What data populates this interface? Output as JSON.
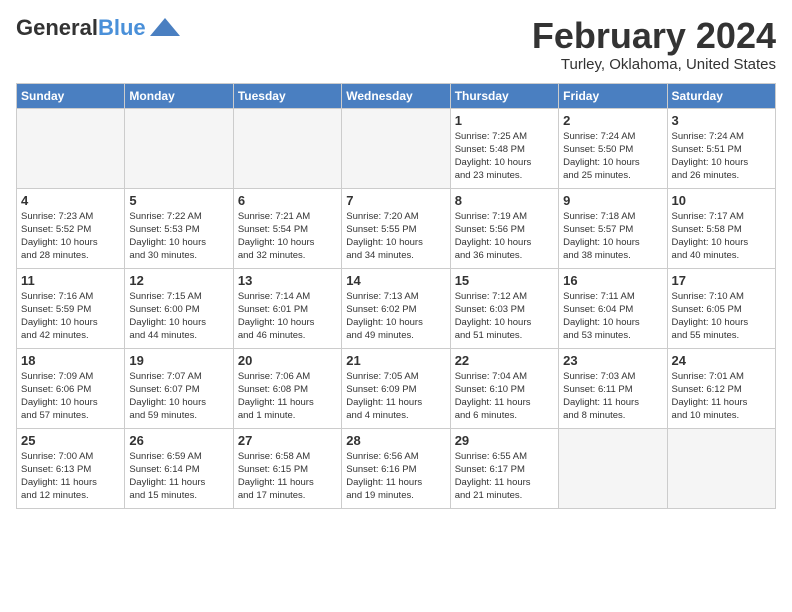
{
  "header": {
    "logo_line1": "General",
    "logo_line2": "Blue",
    "month": "February 2024",
    "location": "Turley, Oklahoma, United States"
  },
  "days_of_week": [
    "Sunday",
    "Monday",
    "Tuesday",
    "Wednesday",
    "Thursday",
    "Friday",
    "Saturday"
  ],
  "weeks": [
    [
      {
        "num": "",
        "info": "",
        "empty": true
      },
      {
        "num": "",
        "info": "",
        "empty": true
      },
      {
        "num": "",
        "info": "",
        "empty": true
      },
      {
        "num": "",
        "info": "",
        "empty": true
      },
      {
        "num": "1",
        "info": "Sunrise: 7:25 AM\nSunset: 5:48 PM\nDaylight: 10 hours\nand 23 minutes.",
        "empty": false
      },
      {
        "num": "2",
        "info": "Sunrise: 7:24 AM\nSunset: 5:50 PM\nDaylight: 10 hours\nand 25 minutes.",
        "empty": false
      },
      {
        "num": "3",
        "info": "Sunrise: 7:24 AM\nSunset: 5:51 PM\nDaylight: 10 hours\nand 26 minutes.",
        "empty": false
      }
    ],
    [
      {
        "num": "4",
        "info": "Sunrise: 7:23 AM\nSunset: 5:52 PM\nDaylight: 10 hours\nand 28 minutes.",
        "empty": false
      },
      {
        "num": "5",
        "info": "Sunrise: 7:22 AM\nSunset: 5:53 PM\nDaylight: 10 hours\nand 30 minutes.",
        "empty": false
      },
      {
        "num": "6",
        "info": "Sunrise: 7:21 AM\nSunset: 5:54 PM\nDaylight: 10 hours\nand 32 minutes.",
        "empty": false
      },
      {
        "num": "7",
        "info": "Sunrise: 7:20 AM\nSunset: 5:55 PM\nDaylight: 10 hours\nand 34 minutes.",
        "empty": false
      },
      {
        "num": "8",
        "info": "Sunrise: 7:19 AM\nSunset: 5:56 PM\nDaylight: 10 hours\nand 36 minutes.",
        "empty": false
      },
      {
        "num": "9",
        "info": "Sunrise: 7:18 AM\nSunset: 5:57 PM\nDaylight: 10 hours\nand 38 minutes.",
        "empty": false
      },
      {
        "num": "10",
        "info": "Sunrise: 7:17 AM\nSunset: 5:58 PM\nDaylight: 10 hours\nand 40 minutes.",
        "empty": false
      }
    ],
    [
      {
        "num": "11",
        "info": "Sunrise: 7:16 AM\nSunset: 5:59 PM\nDaylight: 10 hours\nand 42 minutes.",
        "empty": false
      },
      {
        "num": "12",
        "info": "Sunrise: 7:15 AM\nSunset: 6:00 PM\nDaylight: 10 hours\nand 44 minutes.",
        "empty": false
      },
      {
        "num": "13",
        "info": "Sunrise: 7:14 AM\nSunset: 6:01 PM\nDaylight: 10 hours\nand 46 minutes.",
        "empty": false
      },
      {
        "num": "14",
        "info": "Sunrise: 7:13 AM\nSunset: 6:02 PM\nDaylight: 10 hours\nand 49 minutes.",
        "empty": false
      },
      {
        "num": "15",
        "info": "Sunrise: 7:12 AM\nSunset: 6:03 PM\nDaylight: 10 hours\nand 51 minutes.",
        "empty": false
      },
      {
        "num": "16",
        "info": "Sunrise: 7:11 AM\nSunset: 6:04 PM\nDaylight: 10 hours\nand 53 minutes.",
        "empty": false
      },
      {
        "num": "17",
        "info": "Sunrise: 7:10 AM\nSunset: 6:05 PM\nDaylight: 10 hours\nand 55 minutes.",
        "empty": false
      }
    ],
    [
      {
        "num": "18",
        "info": "Sunrise: 7:09 AM\nSunset: 6:06 PM\nDaylight: 10 hours\nand 57 minutes.",
        "empty": false
      },
      {
        "num": "19",
        "info": "Sunrise: 7:07 AM\nSunset: 6:07 PM\nDaylight: 10 hours\nand 59 minutes.",
        "empty": false
      },
      {
        "num": "20",
        "info": "Sunrise: 7:06 AM\nSunset: 6:08 PM\nDaylight: 11 hours\nand 1 minute.",
        "empty": false
      },
      {
        "num": "21",
        "info": "Sunrise: 7:05 AM\nSunset: 6:09 PM\nDaylight: 11 hours\nand 4 minutes.",
        "empty": false
      },
      {
        "num": "22",
        "info": "Sunrise: 7:04 AM\nSunset: 6:10 PM\nDaylight: 11 hours\nand 6 minutes.",
        "empty": false
      },
      {
        "num": "23",
        "info": "Sunrise: 7:03 AM\nSunset: 6:11 PM\nDaylight: 11 hours\nand 8 minutes.",
        "empty": false
      },
      {
        "num": "24",
        "info": "Sunrise: 7:01 AM\nSunset: 6:12 PM\nDaylight: 11 hours\nand 10 minutes.",
        "empty": false
      }
    ],
    [
      {
        "num": "25",
        "info": "Sunrise: 7:00 AM\nSunset: 6:13 PM\nDaylight: 11 hours\nand 12 minutes.",
        "empty": false
      },
      {
        "num": "26",
        "info": "Sunrise: 6:59 AM\nSunset: 6:14 PM\nDaylight: 11 hours\nand 15 minutes.",
        "empty": false
      },
      {
        "num": "27",
        "info": "Sunrise: 6:58 AM\nSunset: 6:15 PM\nDaylight: 11 hours\nand 17 minutes.",
        "empty": false
      },
      {
        "num": "28",
        "info": "Sunrise: 6:56 AM\nSunset: 6:16 PM\nDaylight: 11 hours\nand 19 minutes.",
        "empty": false
      },
      {
        "num": "29",
        "info": "Sunrise: 6:55 AM\nSunset: 6:17 PM\nDaylight: 11 hours\nand 21 minutes.",
        "empty": false
      },
      {
        "num": "",
        "info": "",
        "empty": true
      },
      {
        "num": "",
        "info": "",
        "empty": true
      }
    ]
  ]
}
